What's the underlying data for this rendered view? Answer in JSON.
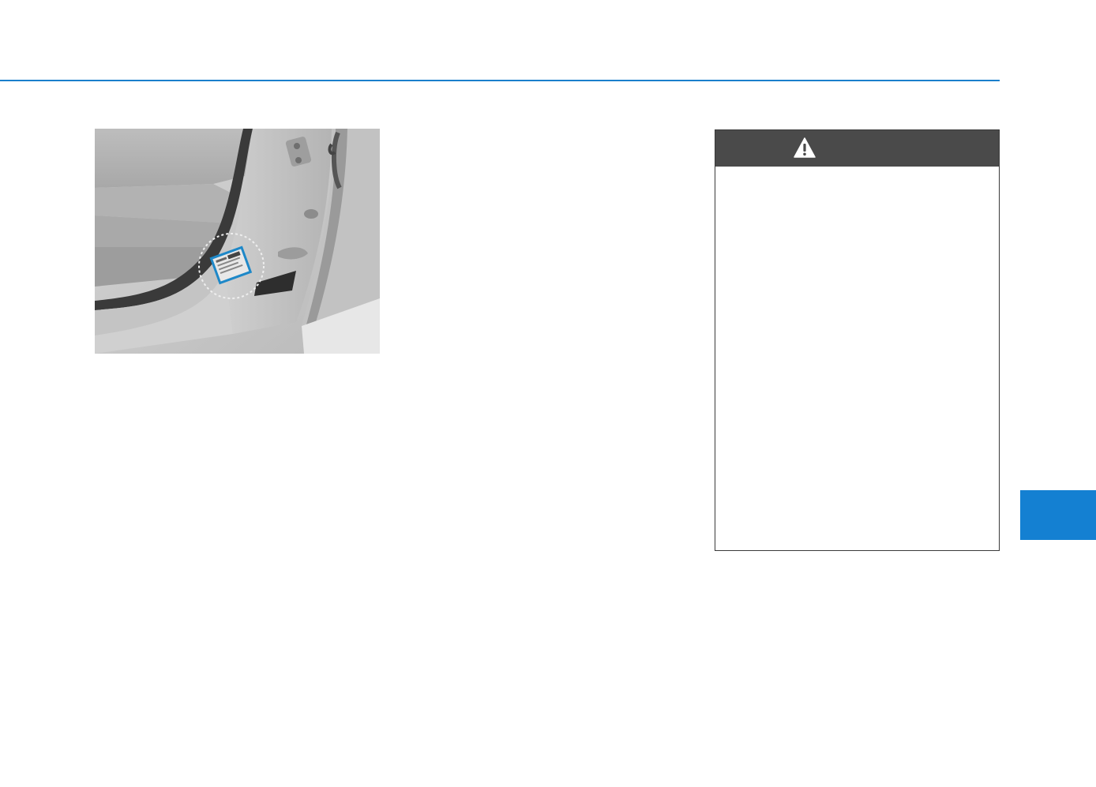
{
  "page": {
    "accent_color": "#1a7fcc",
    "tab_color": "#1480d2"
  },
  "figure": {
    "description_icon": "car-door-pillar-label-illustration",
    "highlight_icon": "dotted-circle-highlight"
  },
  "warning": {
    "header_color": "#4a4a4a",
    "icon": "warning-triangle-icon",
    "title": "",
    "body": ""
  },
  "side_tab": {
    "label": ""
  }
}
